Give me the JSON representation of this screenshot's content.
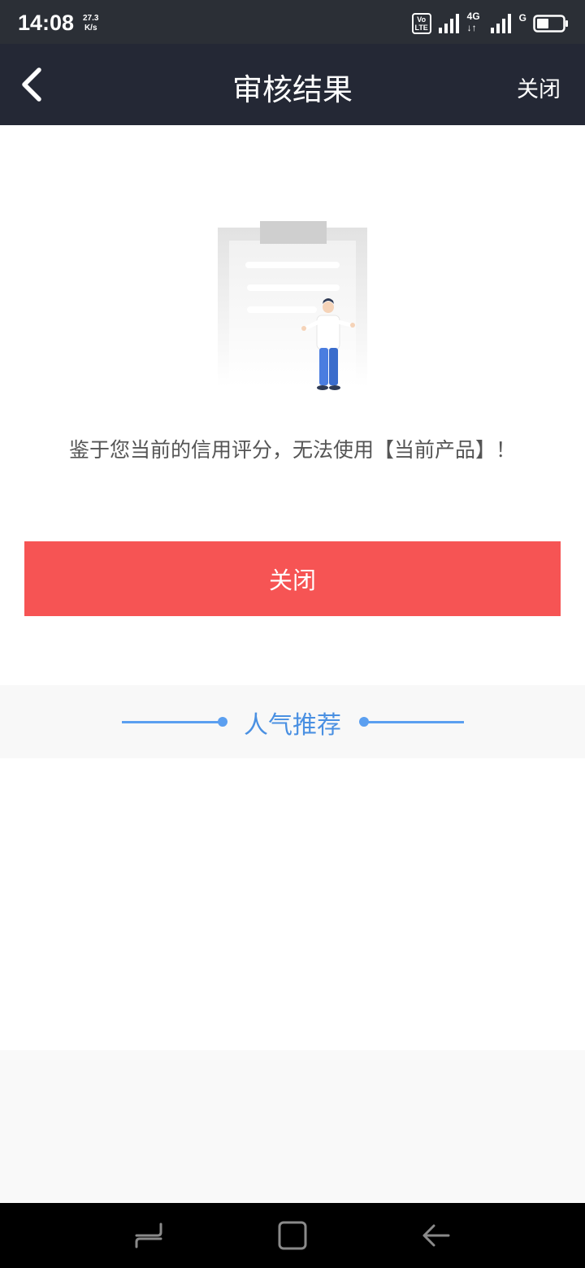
{
  "status_bar": {
    "time": "14:08",
    "speed_value": "27.3",
    "speed_unit": "K/s",
    "volte_top": "Vo",
    "volte_bottom": "LTE",
    "network_label": "4G",
    "network2_label": "G",
    "icons": [
      "volte-icon",
      "signal-icon",
      "network-4g-icon",
      "signal-icon",
      "battery-icon"
    ]
  },
  "header": {
    "title": "审核结果",
    "close_label": "关闭"
  },
  "main": {
    "message": "鉴于您当前的信用评分，无法使用【当前产品】！",
    "close_button_label": "关闭"
  },
  "recommend": {
    "title": "人气推荐",
    "accent_color": "#5b9ff0"
  },
  "colors": {
    "header_bg": "#242835",
    "button_bg": "#f65454"
  },
  "nav_bar": {
    "items": [
      "recent-apps-icon",
      "home-icon",
      "back-icon"
    ]
  }
}
